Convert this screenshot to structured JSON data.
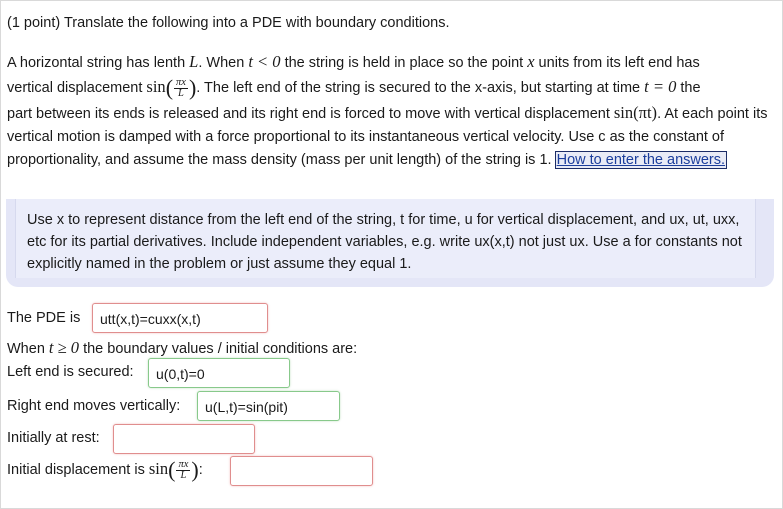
{
  "header": {
    "text": "(1 point) Translate the following into a PDE with boundary conditions."
  },
  "problem": {
    "s1": "A horizontal string has lenth ",
    "var_L": "L",
    "s2": ". When ",
    "cond_t_lt": "t < 0",
    "s3": " the string is held in place so the point ",
    "var_x": "x",
    "s4": " units from its left end has",
    "s5": "vertical displacement ",
    "sin_word": "sin",
    "frac_num": "πx",
    "frac_den": "L",
    "s6": ". The left end of the string is secured to the x-axis, but starting at time ",
    "cond_t_eq": "t = 0",
    "s7": " the",
    "s8": "part between its ends is released and its right end is forced to move with vertical displacement ",
    "sin_pit": "sin(πt)",
    "s9": ". At each point its vertical motion is damped with a force proportional to its instantaneous vertical velocity. Use c as the constant of proportionality, and assume the mass density (mass per unit length) of the string is 1. ",
    "help_link": "How to enter the answers."
  },
  "note": {
    "text": "Use x to represent distance from the left end of the string, t for time, u for vertical displacement, and ux, ut, uxx, etc for its partial derivatives. Include independent variables, e.g. write ux(x,t) not just ux. Use a for constants not explicitly named in the problem or just assume they equal 1."
  },
  "pde": {
    "label": "The PDE is",
    "value": "utt(x,t)=cuxx(x,t)",
    "status": "incorrect"
  },
  "when_line": {
    "s1": "When ",
    "cond": "t ≥ 0",
    "s2": " the boundary values / initial conditions are:"
  },
  "left_end": {
    "label": "Left end is secured:",
    "value": "u(0,t)=0",
    "status": "correct"
  },
  "right_end": {
    "label": "Right end moves vertically:",
    "value": "u(L,t)=sin(pit)",
    "status": "correct"
  },
  "at_rest": {
    "label": "Initially at rest:",
    "value": "",
    "status": "incorrect"
  },
  "init_disp": {
    "label": "Initial displacement is ",
    "sin_word": "sin",
    "frac_num": "πx",
    "frac_den": "L",
    "colon": ":",
    "value": "",
    "status": "incorrect"
  },
  "colors": {
    "correct_border": "#88c98b",
    "incorrect_border": "#e08e8e",
    "note_bg": "#e4e6f7",
    "link": "#1c3e9c"
  }
}
